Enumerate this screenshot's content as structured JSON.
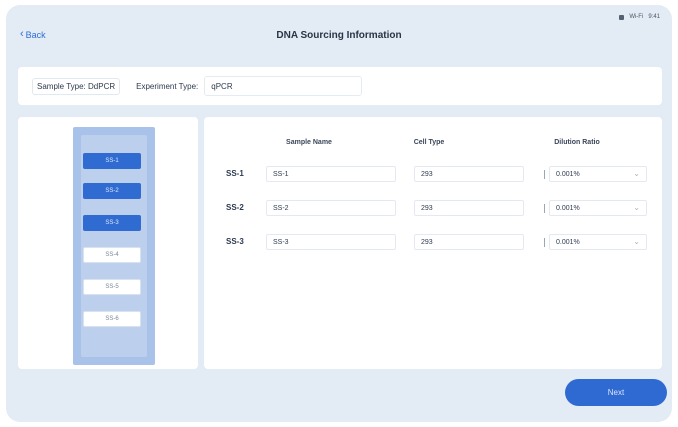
{
  "status": {
    "time": "9:41",
    "network": "Wi-Fi"
  },
  "nav": {
    "back_label": "Back",
    "title": "DNA Sourcing Information"
  },
  "info": {
    "sample_type_label": "Sample Type:",
    "sample_type_value": "DdPCR",
    "experiment_type_label": "Experiment Type:",
    "experiment_type_value": "qPCR"
  },
  "rack": {
    "slots": [
      {
        "label": "SS-1",
        "state": "filled"
      },
      {
        "label": "SS-2",
        "state": "filled"
      },
      {
        "label": "SS-3",
        "state": "filled"
      },
      {
        "label": "SS-4",
        "state": "empty"
      },
      {
        "label": "SS-5",
        "state": "empty"
      },
      {
        "label": "SS-6",
        "state": "empty"
      }
    ]
  },
  "table": {
    "headers": [
      "Sample Name",
      "Cell Type",
      "Dilution Ratio"
    ],
    "rows": [
      {
        "id": "SS-1",
        "name": "SS-1",
        "cell_type": "293",
        "ratio": "0.001%"
      },
      {
        "id": "SS-2",
        "name": "SS-2",
        "cell_type": "293",
        "ratio": "0.001%"
      },
      {
        "id": "SS-3",
        "name": "SS-3",
        "cell_type": "293",
        "ratio": "0.001%"
      }
    ]
  },
  "footer": {
    "next_label": "Next"
  }
}
